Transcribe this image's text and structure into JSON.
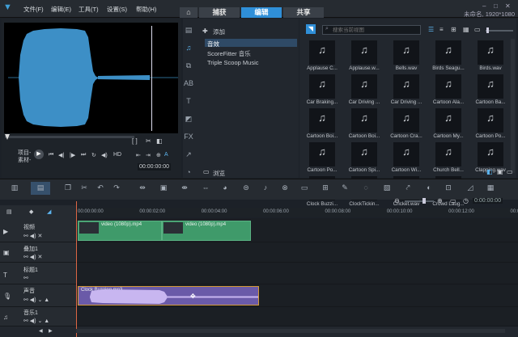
{
  "menu": {
    "file": "文件(F)",
    "edit": "编辑(E)",
    "tools": "工具(T)",
    "settings": "设置(S)",
    "help": "帮助(H)"
  },
  "tabs": {
    "home_icon": "home-icon",
    "capture": "捕获",
    "edit": "编辑",
    "share": "共享"
  },
  "status": "未命名, 1920*1080",
  "preview": {
    "project_label": "项目-",
    "clip_label": "素材-",
    "timecode": "00:00:00:00",
    "ratio": "4:3"
  },
  "library": {
    "add_label": "添加",
    "browse_label": "浏览",
    "items": [
      "音效",
      "ScoreFitter 音乐",
      "Triple Scoop Music"
    ]
  },
  "gallery": {
    "search_placeholder": "搜索当前视图",
    "thumbs": [
      "Applause C...",
      "Applause.w...",
      "Bells.wav",
      "Birds Seagu...",
      "Birds.wav",
      "Car Braking...",
      "Car Driving ...",
      "Car Driving ...",
      "Cartoon Ala...",
      "Cartoon Ba...",
      "Cartoon Boi...",
      "Cartoon Boi...",
      "Cartoon Cra...",
      "Cartoon My...",
      "Cartoon Po...",
      "Cartoon Po...",
      "Cartoon Spi...",
      "Cartoon Wi...",
      "Church Bell...",
      "Clapping.wav",
      "Clock Buzzi...",
      "ClockTickin...",
      "Cricket.wav",
      "Crowd Laug..."
    ]
  },
  "timeline": {
    "ruler": [
      "00:00:00:00",
      "00:00:02:00",
      "00:00:04:00",
      "00:00:06:00",
      "00:00:08:00",
      "00:00:10:00",
      "00:00:12:00",
      "00:00:14:00"
    ],
    "zoom_timecode": "0:00:00:00",
    "tracks": [
      {
        "name": "视频"
      },
      {
        "name": "叠加1"
      },
      {
        "name": "标题1"
      },
      {
        "name": "声音"
      },
      {
        "name": "音乐1"
      }
    ],
    "video_clips": [
      "video (1080p).mp4",
      "video (1080p).mp4"
    ],
    "audio_clip": "Clock Buzzing.mp3"
  },
  "colors": {
    "accent": "#2f8fd8",
    "video_clip": "#3f9a6a",
    "audio_clip": "#6a5aa8",
    "audio_border": "#d49a3a"
  }
}
